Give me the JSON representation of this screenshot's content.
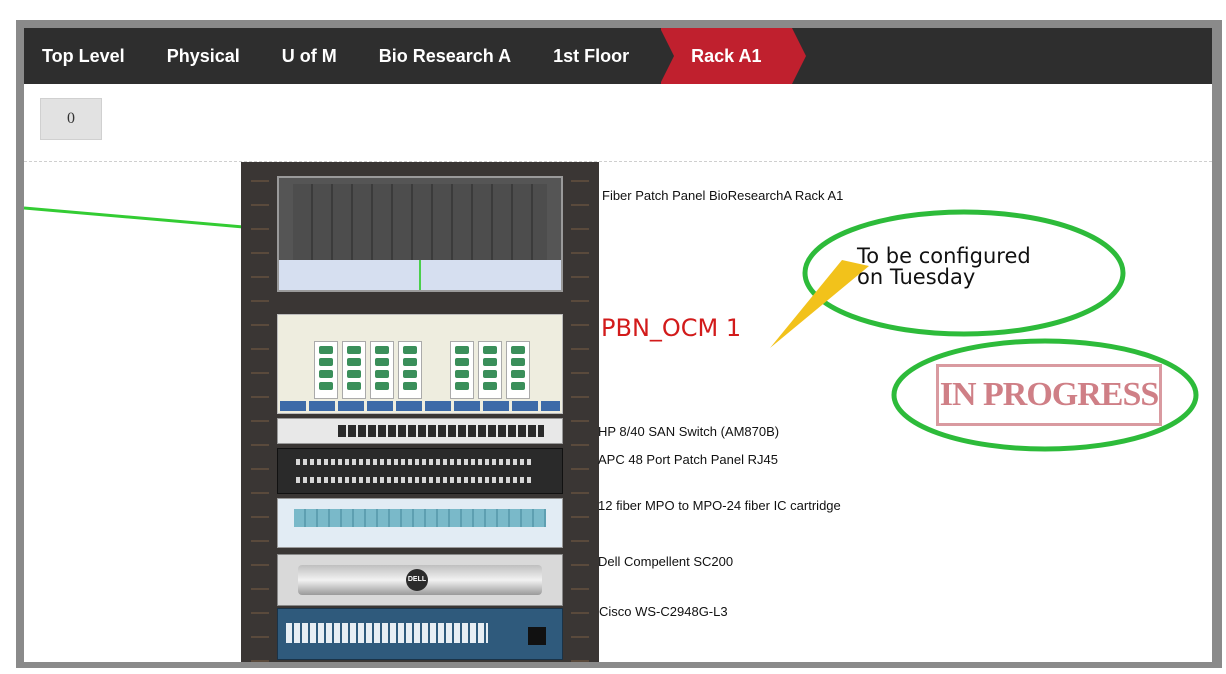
{
  "breadcrumb": {
    "items": [
      "Top Level",
      "Physical",
      "U of M",
      "Bio Research A",
      "1st Floor"
    ],
    "active": "Rack A1"
  },
  "toolbar": {
    "button_label": "0"
  },
  "rack": {
    "devices": [
      "Fiber Patch Panel BioResearchA Rack A1",
      "PBN_OCM 1",
      "HP 8/40 SAN Switch (AM870B)",
      "APC 48 Port Patch Panel RJ45",
      "12 fiber MPO to MPO-24 fiber IC cartridge",
      "Dell Compellent SC200",
      "Cisco WS-C2948G-L3"
    ]
  },
  "annotations": {
    "note_line1": "To be configured",
    "note_line2": "on Tuesday",
    "stamp": "IN PROGRESS"
  },
  "colors": {
    "active_crumb": "#c0202e",
    "link_line": "#33cc33",
    "annotation_circle": "#2dbb3a",
    "device_highlight": "#d21b1b"
  }
}
